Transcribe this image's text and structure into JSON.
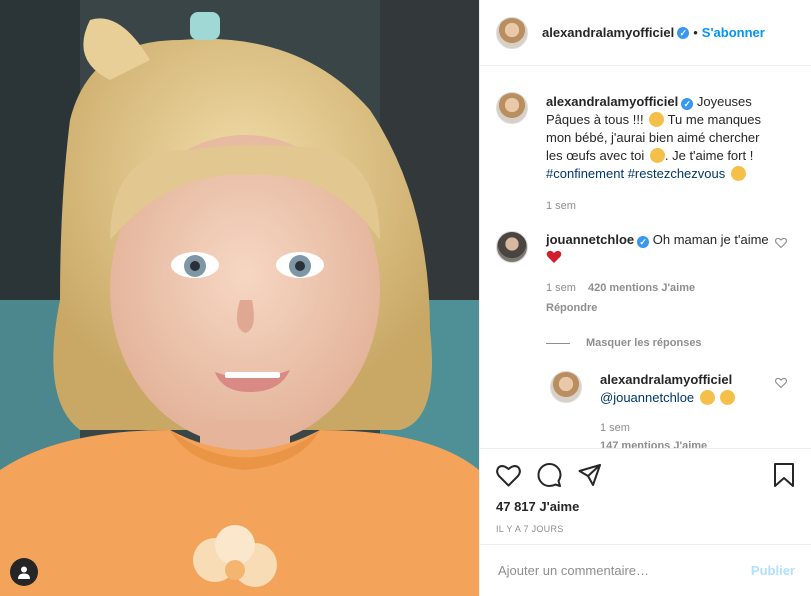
{
  "post": {
    "username": "alexandralamyofficiel",
    "separator": "•",
    "follow_label": "S'abonner",
    "caption_parts": [
      "Joyeuses Pâques à tous !!! ",
      " Tu me manques mon bébé, j'aurai bien aimé chercher les œufs avec toi ",
      ". Je t'aime fort ! "
    ],
    "hashtags": [
      "#confinement",
      "#restezchezvous"
    ],
    "caption_time": "1 sem",
    "likes": "47 817 J'aime",
    "posted_ago": "IL Y A 7 JOURS",
    "comment_placeholder": "Ajouter un commentaire…",
    "publish_label": "Publier"
  },
  "comments": [
    {
      "username": "jouannetchloe",
      "text": "Oh maman je t'aime",
      "time": "1 sem",
      "likes": "420 mentions J'aime",
      "reply_label": "Répondre",
      "hide_replies_label": "Masquer les réponses",
      "replies": [
        {
          "username": "alexandralamyofficiel",
          "mention": "@jouannetchloe",
          "time": "1 sem",
          "likes": "147 mentions J'aime"
        }
      ]
    }
  ],
  "icons": {
    "like": "heart-icon",
    "comment": "comment-icon",
    "share": "paper-plane-icon",
    "save": "bookmark-icon",
    "tag": "user-tag-icon"
  },
  "colors": {
    "accent": "#0095f6",
    "verified": "#3897f0",
    "heart_red": "#ed4956"
  }
}
